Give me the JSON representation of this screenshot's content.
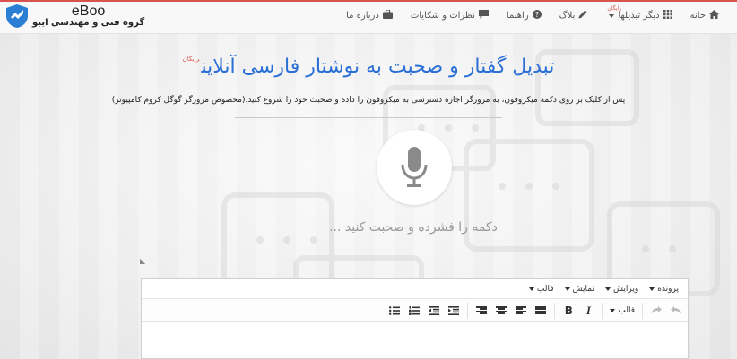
{
  "brand": {
    "title": "eBoo",
    "subtitle": "گروه فنی و مهندسی ایبو"
  },
  "nav": {
    "items": [
      {
        "label": "خانه",
        "icon": "home-icon"
      },
      {
        "label": "دیگر تبدیلها",
        "icon": "grid-icon",
        "badge": "رایگان"
      },
      {
        "label": "بلاگ",
        "icon": "pencil-icon"
      },
      {
        "label": "راهنما",
        "icon": "question-circle-icon"
      },
      {
        "label": "نظرات و شکایات",
        "icon": "comment-icon"
      },
      {
        "label": "درباره ما",
        "icon": "briefcase-icon"
      }
    ]
  },
  "main": {
    "title": "تبدیل گفتار و صحبت به نوشتار فارسی آنلاین",
    "title_badge": "رایگان",
    "instructions": "پس از کلیک بر روی دکمه میکروفون، به مرورگر اجازه دسترسی به میکروفون را داده و صحبت خود را شروع کنید.(مخصوص مرورگر گوگل کروم کامپیوتر)",
    "hint": "دکمه را فشرده و صحبت کنید ..."
  },
  "editor": {
    "menus": [
      "پرونده",
      "ویرایش",
      "نمایش",
      "قالب"
    ],
    "format_label": "قالب"
  },
  "colors": {
    "accent": "#2a6fd6",
    "top_border": "#d9534f",
    "badge": "#d9534f"
  }
}
